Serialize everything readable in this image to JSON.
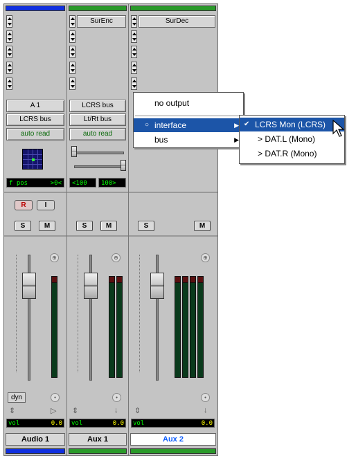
{
  "strips": [
    {
      "name": "Audio 1",
      "color": "#1030e0",
      "output": "A 1",
      "input": "LCRS bus",
      "automation": "auto read",
      "pan_lcd_left": "f pos",
      "pan_lcd_right": ">0<",
      "record_label": "R",
      "input_label": "I",
      "solo_label": "S",
      "mute_label": "M",
      "dyn_label": "dyn",
      "vol_label": "vol",
      "vol_value": "0.0"
    },
    {
      "name": "Aux 1",
      "color": "#2a9a2a",
      "insert": "SurEnc",
      "output": "LCRS bus",
      "input": "Lt/Rt bus",
      "automation": "auto read",
      "pan_left": "<100",
      "pan_right": "100>",
      "solo_label": "S",
      "mute_label": "M",
      "vol_label": "vol",
      "vol_value": "0.0"
    },
    {
      "name": "Aux 2",
      "color": "#2a9a2a",
      "insert": "SurDec",
      "solo_label": "S",
      "mute_label": "M",
      "vol_label": "vol",
      "vol_value": "0.0"
    }
  ],
  "output_menu": {
    "items": [
      "no output",
      "interface",
      "bus"
    ],
    "selected": "interface"
  },
  "interface_submenu": {
    "items": [
      "LCRS Mon (LCRS)",
      "> DAT.L (Mono)",
      "> DAT.R (Mono)"
    ],
    "checked": "LCRS Mon (LCRS)"
  },
  "colors": {
    "menu_highlight": "#1c55a8",
    "meter_bg": "#0a3a1c",
    "lcd_text": "#00ff00",
    "selected_name": "#1060ff"
  }
}
